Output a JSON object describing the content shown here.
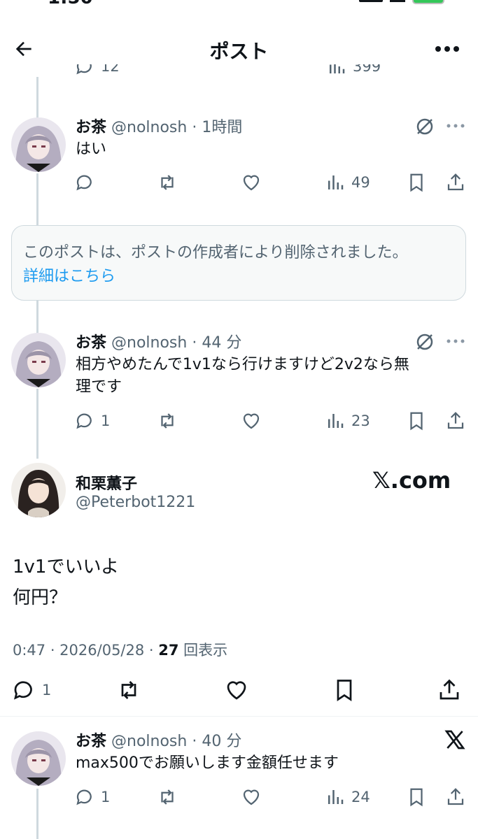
{
  "status_bar": {
    "time": "1:50"
  },
  "header": {
    "title": "ポスト"
  },
  "thread": [
    {
      "display_name": "お茶",
      "handle": "@nolnosh",
      "time": "1時間",
      "text": "はい",
      "replies": "",
      "views": "49"
    },
    {
      "display_name": "お茶",
      "handle": "@nolnosh",
      "time": "44 分",
      "text_line1": "相方やめたんで1v1なら行けますけど2v2なら無",
      "text_line2": "理です",
      "replies": "1",
      "views": "23"
    }
  ],
  "top_partial": {
    "replies": "12",
    "views": "399"
  },
  "deleted_notice": {
    "text": "このポストは、ポストの作成者により削除されました。",
    "link": "詳細はこちら"
  },
  "main_post": {
    "display_name": "和栗薫子",
    "handle": "@Peterbot1221",
    "watermark": "𝕏.com",
    "text_line1": "1v1でいいよ",
    "text_line2": "何円？",
    "timestamp": "0:47 · 2026/05/28 · ",
    "view_count": "27",
    "view_label": " 回表示",
    "replies": "1"
  },
  "reply": {
    "display_name": "お茶",
    "handle": "@nolnosh",
    "time": "40 分",
    "text": "max500でお願いします金額任せます",
    "replies": "1",
    "views": "24"
  },
  "colors": {
    "accent": "#1d9bf0",
    "muted": "#536471",
    "text": "#0f1419"
  },
  "icons": [
    "back-arrow-icon",
    "more-icon",
    "reply-icon",
    "retweet-icon",
    "like-icon",
    "views-icon",
    "bookmark-icon",
    "share-icon",
    "grok-icon",
    "x-logo-icon"
  ]
}
